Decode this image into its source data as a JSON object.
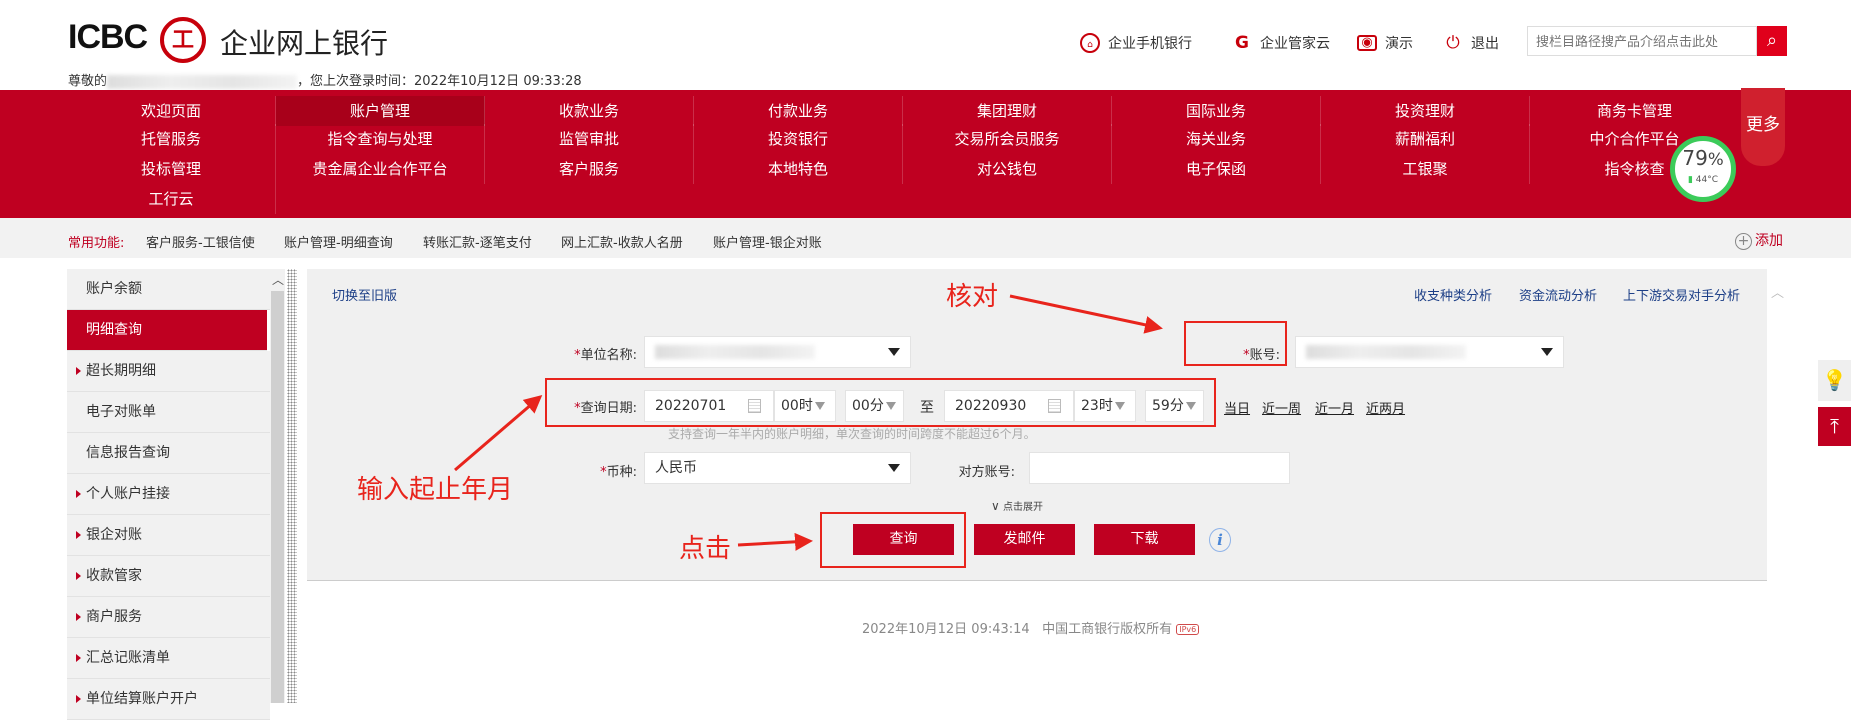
{
  "header": {
    "logo_text": "ICBC",
    "logo_seal": "工",
    "title": "企业网上银行",
    "welcome_prefix": "尊敬的",
    "welcome_suffix": "，您上次登录时间：2022年10月12日 09:33:28",
    "links": [
      {
        "icon": "mobile-bank-icon",
        "label": "企业手机银行"
      },
      {
        "icon": "butler-cloud-icon",
        "label": "企业管家云"
      },
      {
        "icon": "demo-icon",
        "label": "演示"
      },
      {
        "icon": "power-icon",
        "label": "退出"
      }
    ],
    "search_placeholder": "搜栏目路径搜产品介绍点击此处"
  },
  "nav": {
    "rows": [
      [
        "欢迎页面",
        "账户管理",
        "收款业务",
        "付款业务",
        "集团理财",
        "国际业务",
        "投资理财",
        "商务卡管理"
      ],
      [
        "托管服务",
        "指令查询与处理",
        "监管审批",
        "投资银行",
        "交易所会员服务",
        "海关业务",
        "薪酬福利",
        "中介合作平台"
      ],
      [
        "投标管理",
        "贵金属企业合作平台",
        "客户服务",
        "本地特色",
        "对公钱包",
        "电子保函",
        "工银聚",
        "指令核查"
      ],
      [
        "工行云"
      ]
    ],
    "active": "账户管理",
    "more": "更多"
  },
  "gauge": {
    "percent": "79",
    "percent_sign": "%",
    "temp": "44°C"
  },
  "common": {
    "label": "常用功能:",
    "items": [
      "客户服务-工银信使",
      "账户管理-明细查询",
      "转账汇款-逐笔支付",
      "网上汇款-收款人名册",
      "账户管理-银企对账"
    ],
    "add": "添加"
  },
  "sidebar": {
    "items": [
      {
        "label": "账户余额",
        "arrow": false
      },
      {
        "label": "明细查询",
        "arrow": false,
        "active": true
      },
      {
        "label": "超长期明细",
        "arrow": true
      },
      {
        "label": "电子对账单",
        "arrow": false
      },
      {
        "label": "信息报告查询",
        "arrow": false
      },
      {
        "label": "个人账户挂接",
        "arrow": true
      },
      {
        "label": "银企对账",
        "arrow": true
      },
      {
        "label": "收款管家",
        "arrow": true
      },
      {
        "label": "商户服务",
        "arrow": true
      },
      {
        "label": "汇总记账清单",
        "arrow": true
      },
      {
        "label": "单位结算账户开户",
        "arrow": true
      }
    ]
  },
  "main": {
    "switch_old": "切换至旧版",
    "analysis_links": [
      "收支种类分析",
      "资金流动分析",
      "上下游交易对手分析"
    ],
    "form": {
      "required": "*",
      "unit_label": "单位名称:",
      "account_label": "账号:",
      "date_label": "查询日期:",
      "start_date": "20220701",
      "start_hour": "00时",
      "start_min": "00分",
      "to": "至",
      "end_date": "20220930",
      "end_hour": "23时",
      "end_min": "59分",
      "quick": [
        "当日",
        "近一周",
        "近一月",
        "近两月"
      ],
      "hint": "支持查询一年半内的账户明细，单次查询的时间跨度不能超过6个月。",
      "currency_label": "币种:",
      "currency": "人民币",
      "counter_label": "对方账号:",
      "counter_value": "",
      "expand": "点击展开"
    },
    "buttons": {
      "query": "查询",
      "email": "发邮件",
      "download": "下载"
    }
  },
  "annotations": {
    "verify": "核对",
    "input_dates": "输入起止年月",
    "click": "点击"
  },
  "footer": {
    "text": "2022年10月12日 09:43:14   中国工商银行版权所有",
    "badge": "IPv6"
  },
  "colors": {
    "brand": "#bf0021",
    "annotation": "#e8241c",
    "link": "#1d3f87"
  }
}
